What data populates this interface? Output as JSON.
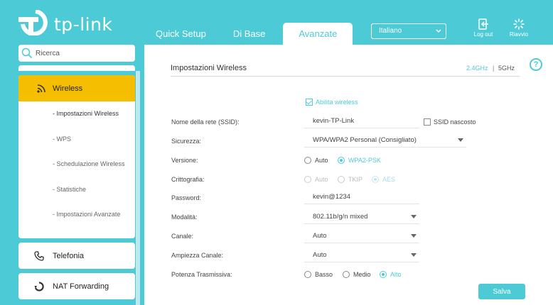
{
  "brand": {
    "logo_text": "tp-link",
    "color": "#4ccbd6"
  },
  "nav": {
    "tabs": [
      "Quick Setup",
      "Di Base",
      "Avanzate"
    ],
    "active": "Avanzate"
  },
  "language": {
    "selected": "Italiano"
  },
  "header_buttons": {
    "logout": "Log out",
    "reboot": "Riavvio"
  },
  "search": {
    "placeholder": "Ricerca"
  },
  "sidebar": {
    "active": {
      "label": "Wireless",
      "icon": "wireless-icon",
      "color": "#f6be00"
    },
    "subitems": [
      "- Impostazioni Wireless",
      "- WPS",
      "- Schedulazione Wireless",
      "- Statistiche",
      "- Impostazioni Avanzate"
    ],
    "items": [
      {
        "label": "Telefonia",
        "icon": "phone-icon"
      },
      {
        "label": "NAT Forwarding",
        "icon": "nat-icon"
      }
    ]
  },
  "page": {
    "title": "Impostazioni Wireless",
    "band_24": "2.4GHz",
    "band_sep": "|",
    "band_5": "5GHz",
    "help": "?"
  },
  "form": {
    "enable_wireless": "Abilita wireless",
    "ssid_label": "Nome della rete (SSID):",
    "ssid_value": "kevin-TP-Link",
    "ssid_hidden": "SSID nascosto",
    "security_label": "Sicurezza:",
    "security_value": "WPA/WPA2 Personal (Consigliato)",
    "version_label": "Versione:",
    "version_options": [
      "Auto",
      "WPA2-PSK"
    ],
    "version_selected": "WPA2-PSK",
    "encryption_label": "Crittografia:",
    "encryption_options": [
      "Auto",
      "TKIP",
      "AES"
    ],
    "encryption_selected": "AES",
    "password_label": "Password:",
    "password_value": "kevin@1234",
    "mode_label": "Modalità:",
    "mode_value": "802.11b/g/n mixed",
    "channel_label": "Canale:",
    "channel_value": "Auto",
    "width_label": "Ampiezza Canale:",
    "width_value": "Auto",
    "power_label": "Potenza Trasmissiva:",
    "power_options": [
      "Basso",
      "Medio",
      "Alto"
    ],
    "power_selected": "Alto",
    "save": "Salva"
  }
}
